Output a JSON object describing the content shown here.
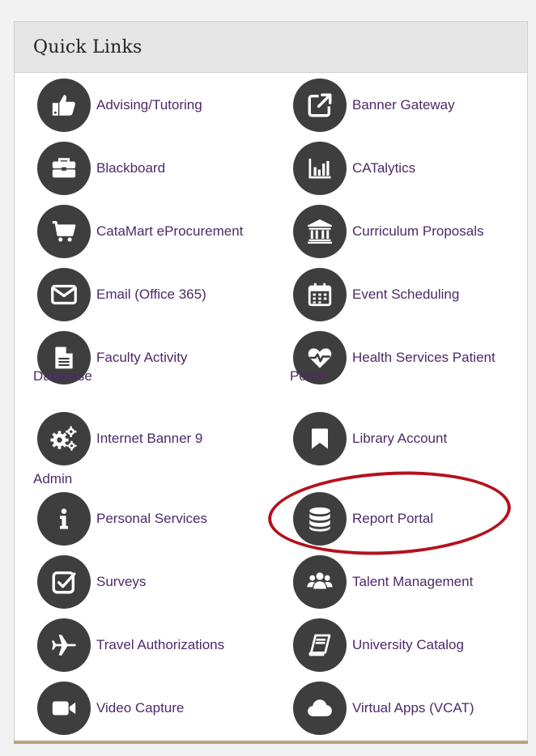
{
  "panel": {
    "title": "Quick Links"
  },
  "links": {
    "advising": "Advising/Tutoring",
    "banner_gateway": "Banner Gateway",
    "blackboard": "Blackboard",
    "catalytics": "CATalytics",
    "catamart": "CataMart eProcurement",
    "curriculum": "Curriculum Proposals",
    "email": "Email (Office 365)",
    "event_scheduling": "Event Scheduling",
    "faculty_activity": "Faculty Activity",
    "faculty_activity_wrap": "Database",
    "health_services": "Health Services Patient",
    "health_services_wrap": "Portal",
    "internet_banner": "Internet Banner 9",
    "internet_banner_wrap": "Admin",
    "library_account": "Library Account",
    "personal_services": "Personal Services",
    "report_portal": "Report Portal",
    "surveys": "Surveys",
    "talent_management": "Talent Management",
    "travel": "Travel Authorizations",
    "university_catalog": "University Catalog",
    "video_capture": "Video Capture",
    "virtual_apps": "Virtual Apps (VCAT)"
  },
  "colors": {
    "link": "#4b2a6a",
    "icon_bg": "#3e3e3e",
    "highlight": "#b3121c",
    "accent_bar": "#b8a57a"
  },
  "icons": [
    "thumbs-up-icon",
    "external-link-icon",
    "briefcase-icon",
    "bar-chart-icon",
    "shopping-cart-icon",
    "institution-icon",
    "envelope-icon",
    "calendar-icon",
    "document-icon",
    "heartbeat-icon",
    "cogs-icon",
    "bookmark-icon",
    "info-icon",
    "database-icon",
    "check-square-icon",
    "users-icon",
    "plane-icon",
    "book-icon",
    "video-camera-icon",
    "cloud-icon"
  ]
}
